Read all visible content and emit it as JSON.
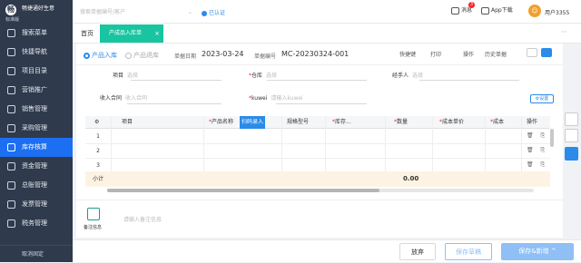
{
  "app": {
    "name": "畅捷通好生意",
    "edition": "标准版"
  },
  "header": {
    "search_placeholder": "搜索单据编号/客户",
    "auth_label": "已认证",
    "messages_label": "消息",
    "messages_count": "3",
    "app_download_label": "App下载",
    "user_name": "用户3355"
  },
  "sidebar": {
    "items": [
      {
        "label": "搜索菜单"
      },
      {
        "label": "快捷导航"
      },
      {
        "label": "项目目录"
      },
      {
        "label": "营销推广"
      },
      {
        "label": "销售管理"
      },
      {
        "label": "采购管理"
      },
      {
        "label": "库存核算"
      },
      {
        "label": "资金管理"
      },
      {
        "label": "总账管理"
      },
      {
        "label": "发票管理"
      },
      {
        "label": "税务管理"
      }
    ],
    "active_index": 6,
    "footer_label": "取消固定"
  },
  "tabs": {
    "home": "首页",
    "active": "产成品入库单",
    "close": "×",
    "more": "⋯"
  },
  "form": {
    "radio_product_in": "产品入库",
    "radio_product_return": "产品退库",
    "date_label": "单据日期",
    "date_value": "2023-03-24",
    "doc_no_label": "单据编号",
    "doc_no_value": "MC-20230324-001",
    "actions": [
      "快捷键",
      "打印",
      "操作",
      "历史单据"
    ],
    "project_label": "项目",
    "project_placeholder": "选择",
    "warehouse_label": "仓库",
    "warehouse_placeholder": "选择",
    "handler_label": "经手人",
    "handler_placeholder": "选择",
    "income_contract_label": "收入合同",
    "income_contract_placeholder": "收入合同",
    "kuwei_label": "kuwei",
    "kuwei_placeholder": "请输入kuwei",
    "settings_label": "设置"
  },
  "grid": {
    "columns": [
      "项目",
      "产品名称",
      "扫码录入",
      "规格型号",
      "库存...",
      "数量",
      "成本单价",
      "成本",
      "操作"
    ],
    "rows": [
      "1",
      "2",
      "3"
    ],
    "subtotal_label": "小计",
    "subtotal_qty": "0.00",
    "row_action_icons": "🗑 ⎘"
  },
  "note": {
    "label": "备注信息",
    "placeholder": "请输入备注信息"
  },
  "footer": {
    "cancel": "放弃",
    "save_draft": "保存草稿",
    "save_new": "保存&新增"
  },
  "colors": {
    "sidebar": "#2f3a4c",
    "active": "#1d6ff2",
    "tab": "#18c5a0",
    "primary": "#2a8be9",
    "disabled": "#8fbff5"
  }
}
